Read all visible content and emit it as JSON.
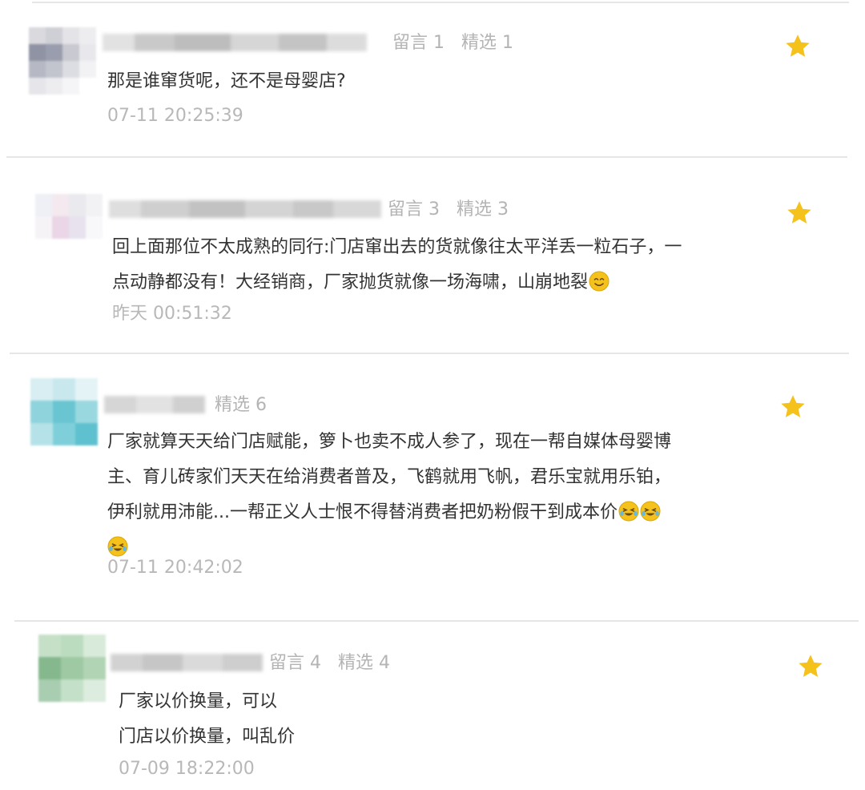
{
  "colors": {
    "star": "#f5c21b",
    "divider": "#e6e6e6",
    "body_text": "#333333",
    "meta_text": "#b4b4b4"
  },
  "comments": [
    {
      "stats": [
        {
          "label": "留言",
          "value": "1"
        },
        {
          "label": "精选",
          "value": "1"
        }
      ],
      "lines": [
        "那是谁窜货呢，还不是母婴店?"
      ],
      "time": "07-11 20:25:39"
    },
    {
      "stats": [
        {
          "label": "留言",
          "value": "3"
        },
        {
          "label": "精选",
          "value": "3"
        }
      ],
      "lines": [
        "回上面那位不太成熟的同行:门店窜出去的货就像往太平洋丢一粒石子，一",
        "点动静都没有！大经销商，厂家抛货就像一场海啸，山崩地裂"
      ],
      "emojis": [
        "smile-emoji"
      ],
      "time": "昨天 00:51:32"
    },
    {
      "stats": [
        {
          "label": "精选",
          "value": "6"
        }
      ],
      "lines": [
        "厂家就算天天给门店赋能，箩卜也卖不成人参了，现在一帮自媒体母婴博",
        "主、育儿砖家们天天在给消费者普及，飞鹤就用飞帆，君乐宝就用乐铂，",
        "伊利就用沛能...一帮正义人士恨不得替消费者把奶粉假干到成本价"
      ],
      "emojis": [
        "laugh-cry-emoji",
        "laugh-cry-emoji",
        "laugh-cry-emoji"
      ],
      "time": "07-11 20:42:02"
    },
    {
      "stats": [
        {
          "label": "留言",
          "value": "4"
        },
        {
          "label": "精选",
          "value": "4"
        }
      ],
      "lines": [
        "厂家以价换量，可以",
        "门店以价换量，叫乱价"
      ],
      "time": "07-09 18:22:00"
    }
  ]
}
